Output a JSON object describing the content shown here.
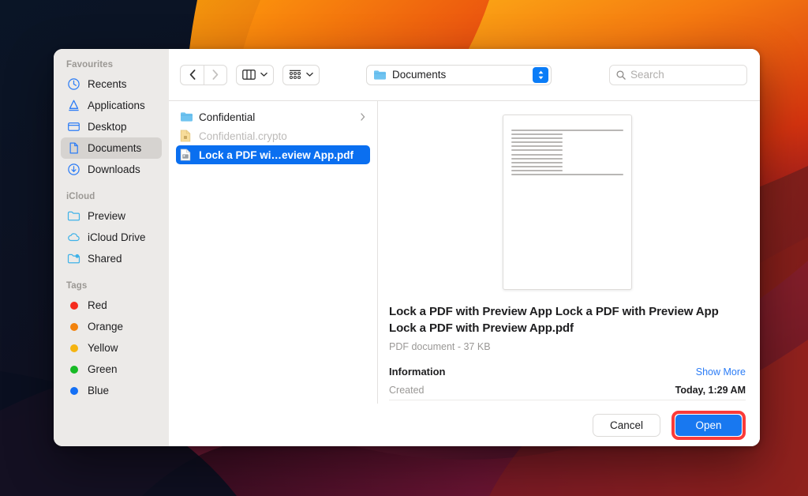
{
  "dialog": {
    "sidebar": {
      "sections": [
        {
          "header": "Favourites",
          "items": [
            {
              "label": "Recents",
              "icon": "clock-icon",
              "selected": false
            },
            {
              "label": "Applications",
              "icon": "applications-icon",
              "selected": false
            },
            {
              "label": "Desktop",
              "icon": "desktop-icon",
              "selected": false
            },
            {
              "label": "Documents",
              "icon": "document-icon",
              "selected": true
            },
            {
              "label": "Downloads",
              "icon": "download-icon",
              "selected": false
            }
          ]
        },
        {
          "header": "iCloud",
          "items": [
            {
              "label": "Preview",
              "icon": "folder-icon",
              "selected": false
            },
            {
              "label": "iCloud Drive",
              "icon": "cloud-icon",
              "selected": false
            },
            {
              "label": "Shared",
              "icon": "shared-folder-icon",
              "selected": false
            }
          ]
        },
        {
          "header": "Tags",
          "items": [
            {
              "label": "Red",
              "icon": "tag-dot-icon",
              "color": "#f52b1e",
              "selected": false
            },
            {
              "label": "Orange",
              "icon": "tag-dot-icon",
              "color": "#f2820c",
              "selected": false
            },
            {
              "label": "Yellow",
              "icon": "tag-dot-icon",
              "color": "#f5b411",
              "selected": false
            },
            {
              "label": "Green",
              "icon": "tag-dot-icon",
              "color": "#17ba25",
              "selected": false
            },
            {
              "label": "Blue",
              "icon": "tag-dot-icon",
              "color": "#1470f5",
              "selected": false
            }
          ]
        }
      ]
    },
    "toolbar": {
      "back_icon": "chevron-left-icon",
      "forward_icon": "chevron-right-icon",
      "view_mode_icon": "column-view-icon",
      "group_by_icon": "group-by-icon",
      "location": "Documents",
      "location_icon": "folder-icon",
      "search_placeholder": "Search",
      "search_value": "",
      "search_icon": "search-icon"
    },
    "files": [
      {
        "name": "Confidential",
        "icon": "folder-icon",
        "state": "normal",
        "has_chevron": true
      },
      {
        "name": "Confidential.crypto",
        "icon": "locked-file-icon",
        "state": "disabled",
        "has_chevron": false
      },
      {
        "name": "Lock a PDF wi…eview App.pdf",
        "icon": "pdf-file-icon",
        "state": "selected",
        "has_chevron": false
      }
    ],
    "preview": {
      "thumbnail_line_count": 12,
      "title": "Lock a PDF with Preview App Lock a PDF with Preview App Lock a PDF with Preview App.pdf",
      "subtitle": "PDF document - 37 KB",
      "information_label": "Information",
      "show_more_label": "Show More",
      "rows": [
        {
          "key": "Created",
          "value": "Today, 1:29 AM"
        }
      ]
    },
    "buttons": {
      "cancel_label": "Cancel",
      "open_label": "Open"
    }
  },
  "colors": {
    "selection_blue": "#0a6ff0",
    "accent_blue": "#1878f0",
    "link_blue": "#2b7cf6",
    "highlight_red": "#fb3b39",
    "sidebar_bg": "#eceae8",
    "sidebar_selected": "#d6d3d0"
  }
}
